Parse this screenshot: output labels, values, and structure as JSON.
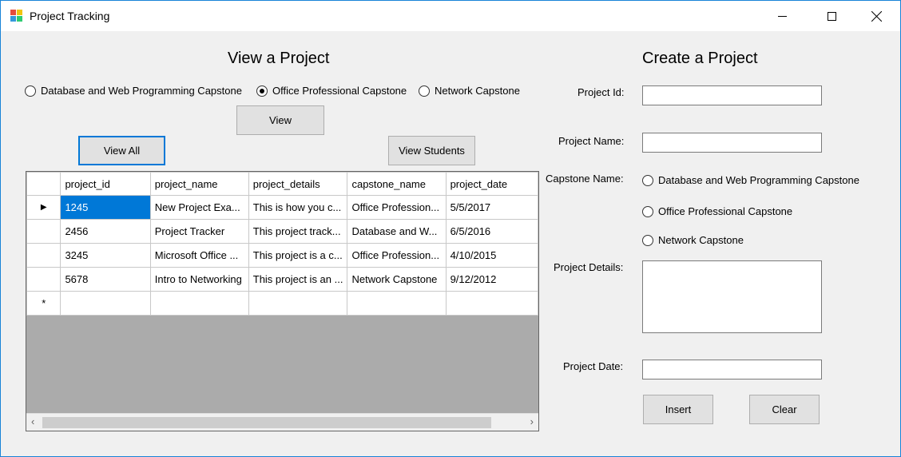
{
  "window": {
    "title": "Project Tracking"
  },
  "view": {
    "heading": "View a Project",
    "radios": [
      {
        "label": "Database and Web Programming Capstone",
        "checked": false
      },
      {
        "label": "Office Professional Capstone",
        "checked": true
      },
      {
        "label": "Network Capstone",
        "checked": false
      }
    ],
    "view_button": "View",
    "view_all_button": "View All",
    "view_students_button": "View Students"
  },
  "grid": {
    "columns": [
      "project_id",
      "project_name",
      "project_details",
      "capstone_name",
      "project_date"
    ],
    "rows": [
      [
        "1245",
        "New Project Exa...",
        "This is how you c...",
        "Office Profession...",
        "5/5/2017"
      ],
      [
        "2456",
        "Project Tracker",
        "This project track...",
        "Database and W...",
        "6/5/2016"
      ],
      [
        "3245",
        "Microsoft Office ...",
        "This project is a c...",
        "Office Profession...",
        "4/10/2015"
      ],
      [
        "5678",
        "Intro to Networking",
        "This project is an ...",
        "Network Capstone",
        "9/12/2012"
      ]
    ],
    "current_row_marker": "▶",
    "new_row_marker": "*"
  },
  "create": {
    "heading": "Create a Project",
    "project_id_label": "Project Id:",
    "project_name_label": "Project Name:",
    "capstone_name_label": "Capstone Name:",
    "capstone_radios": [
      {
        "label": "Database and Web Programming Capstone",
        "checked": false
      },
      {
        "label": "Office Professional Capstone",
        "checked": false
      },
      {
        "label": "Network Capstone",
        "checked": false
      }
    ],
    "project_details_label": "Project Details:",
    "project_date_label": "Project Date:",
    "insert_button": "Insert",
    "clear_button": "Clear"
  }
}
